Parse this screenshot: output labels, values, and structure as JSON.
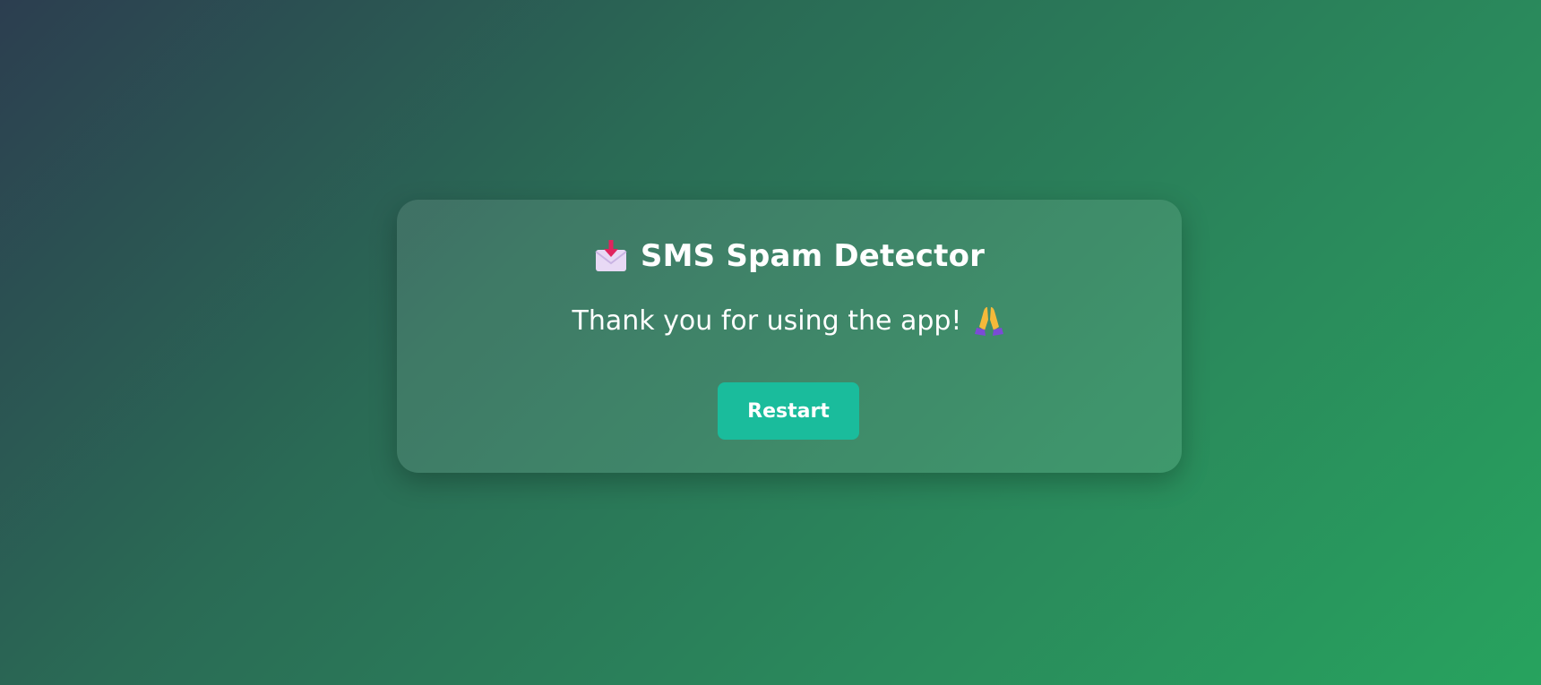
{
  "app": {
    "title": "SMS Spam Detector",
    "title_icon": "inbox-tray-icon"
  },
  "message": {
    "text": "Thank you for using the app!",
    "icon": "folded-hands-icon"
  },
  "actions": {
    "restart_label": "Restart"
  },
  "colors": {
    "button": "#1abc9c",
    "background_start": "#2c3e50",
    "background_end": "#27a35e"
  }
}
